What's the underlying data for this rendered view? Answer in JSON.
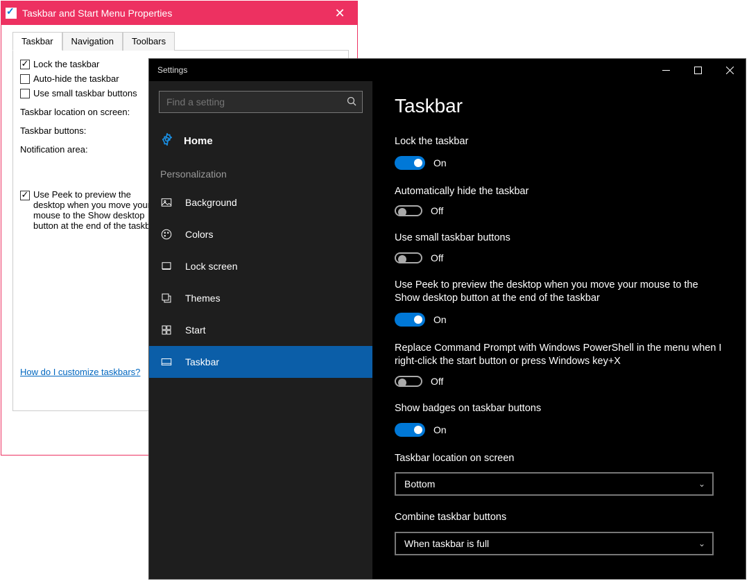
{
  "props": {
    "title": "Taskbar and Start Menu Properties",
    "tabs": [
      "Taskbar",
      "Navigation",
      "Toolbars"
    ],
    "lock": "Lock the taskbar",
    "autohide": "Auto-hide the taskbar",
    "small": "Use small taskbar buttons",
    "loc_label": "Taskbar location on screen:",
    "btn_label": "Taskbar buttons:",
    "notif_label": "Notification area:",
    "peek": "Use Peek to preview the desktop when you move your mouse to the Show desktop button at the end of the taskbar",
    "link": "How do I customize taskbars?"
  },
  "settings": {
    "title": "Settings",
    "search_placeholder": "Find a setting",
    "home": "Home",
    "section": "Personalization",
    "nav": {
      "background": "Background",
      "colors": "Colors",
      "lockscreen": "Lock screen",
      "themes": "Themes",
      "start": "Start",
      "taskbar": "Taskbar"
    }
  },
  "content": {
    "heading": "Taskbar",
    "lock": {
      "label": "Lock the taskbar",
      "state": "On"
    },
    "autohide": {
      "label": "Automatically hide the taskbar",
      "state": "Off"
    },
    "small": {
      "label": "Use small taskbar buttons",
      "state": "Off"
    },
    "peek": {
      "label": "Use Peek to preview the desktop when you move your mouse to the Show desktop button at the end of the taskbar",
      "state": "On"
    },
    "powershell": {
      "label": "Replace Command Prompt with Windows PowerShell in the menu when I right-click the start button or press Windows key+X",
      "state": "Off"
    },
    "badges": {
      "label": "Show badges on taskbar buttons",
      "state": "On"
    },
    "location": {
      "label": "Taskbar location on screen",
      "value": "Bottom"
    },
    "combine": {
      "label": "Combine taskbar buttons",
      "value": "When taskbar is full"
    }
  }
}
